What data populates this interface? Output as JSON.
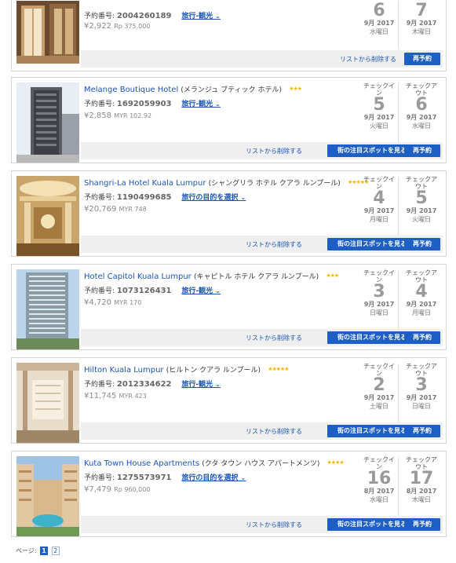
{
  "labels": {
    "reservation_prefix": "予約番号:",
    "checkin": "チェックイ ン",
    "checkout": "チェックア ウト",
    "remove": "リストから削除する",
    "sights": "街の注目スポットを見る",
    "book": "再予約"
  },
  "colors": {
    "accent": "#1d5fc4",
    "link": "#1a55b3",
    "star": "#f2b600"
  },
  "bookings": [
    {
      "name": "",
      "name_jp": "",
      "stars": "",
      "reservation_no": "2004260189",
      "purpose": "旅行-観光",
      "price_jpy": "¥2,922",
      "price_local": "Rp 375,000",
      "checkin": {
        "day": "6",
        "ym": "9月 2017",
        "weekday": "水曜日"
      },
      "checkout": {
        "day": "7",
        "ym": "9月 2017",
        "weekday": "木曜日"
      },
      "has_sights": false
    },
    {
      "name": "Melange Boutique Hotel",
      "name_jp": "(メランジュ ブティック ホテル)",
      "stars": "★★★",
      "reservation_no": "1692059903",
      "purpose": "旅行-観光",
      "price_jpy": "¥2,858",
      "price_local": "MYR 102.92",
      "checkin": {
        "day": "5",
        "ym": "9月 2017",
        "weekday": "火曜日"
      },
      "checkout": {
        "day": "6",
        "ym": "9月 2017",
        "weekday": "水曜日"
      },
      "has_sights": true
    },
    {
      "name": "Shangri-La Hotel Kuala Lumpur",
      "name_jp": "(シャングリラ ホテル クアラ ルンプール)",
      "stars": "★★★★★",
      "reservation_no": "1190499685",
      "purpose": "旅行の目的を選択",
      "price_jpy": "¥20,769",
      "price_local": "MYR 748",
      "checkin": {
        "day": "4",
        "ym": "9月 2017",
        "weekday": "月曜日"
      },
      "checkout": {
        "day": "5",
        "ym": "9月 2017",
        "weekday": "火曜日"
      },
      "has_sights": true
    },
    {
      "name": "Hotel Capitol Kuala Lumpur",
      "name_jp": "(キャピトル ホテル クアラ ルンプール)",
      "stars": "★★★",
      "reservation_no": "1073126431",
      "purpose": "旅行-観光",
      "price_jpy": "¥4,720",
      "price_local": "MYR 170",
      "checkin": {
        "day": "3",
        "ym": "9月 2017",
        "weekday": "日曜日"
      },
      "checkout": {
        "day": "4",
        "ym": "9月 2017",
        "weekday": "月曜日"
      },
      "has_sights": true
    },
    {
      "name": "Hilton Kuala Lumpur",
      "name_jp": "(ヒルトン クアラ ルンプール)",
      "stars": "★★★★★",
      "reservation_no": "2012334622",
      "purpose": "旅行-観光",
      "price_jpy": "¥11,745",
      "price_local": "MYR 423",
      "checkin": {
        "day": "2",
        "ym": "9月 2017",
        "weekday": "土曜日"
      },
      "checkout": {
        "day": "3",
        "ym": "9月 2017",
        "weekday": "日曜日"
      },
      "has_sights": true
    },
    {
      "name": "Kuta Town House Apartments",
      "name_jp": "(クタ タウン ハウス アパートメンツ)",
      "stars": "★★★★",
      "reservation_no": "1275573971",
      "purpose": "旅行の目的を選択",
      "price_jpy": "¥7,479",
      "price_local": "Rp 960,000",
      "checkin": {
        "day": "16",
        "ym": "8月 2017",
        "weekday": "水曜日"
      },
      "checkout": {
        "day": "17",
        "ym": "8月 2017",
        "weekday": "木曜日"
      },
      "has_sights": true
    }
  ],
  "pagination": {
    "label": "ページ:",
    "pages": [
      "1",
      "2"
    ],
    "current": "1"
  }
}
